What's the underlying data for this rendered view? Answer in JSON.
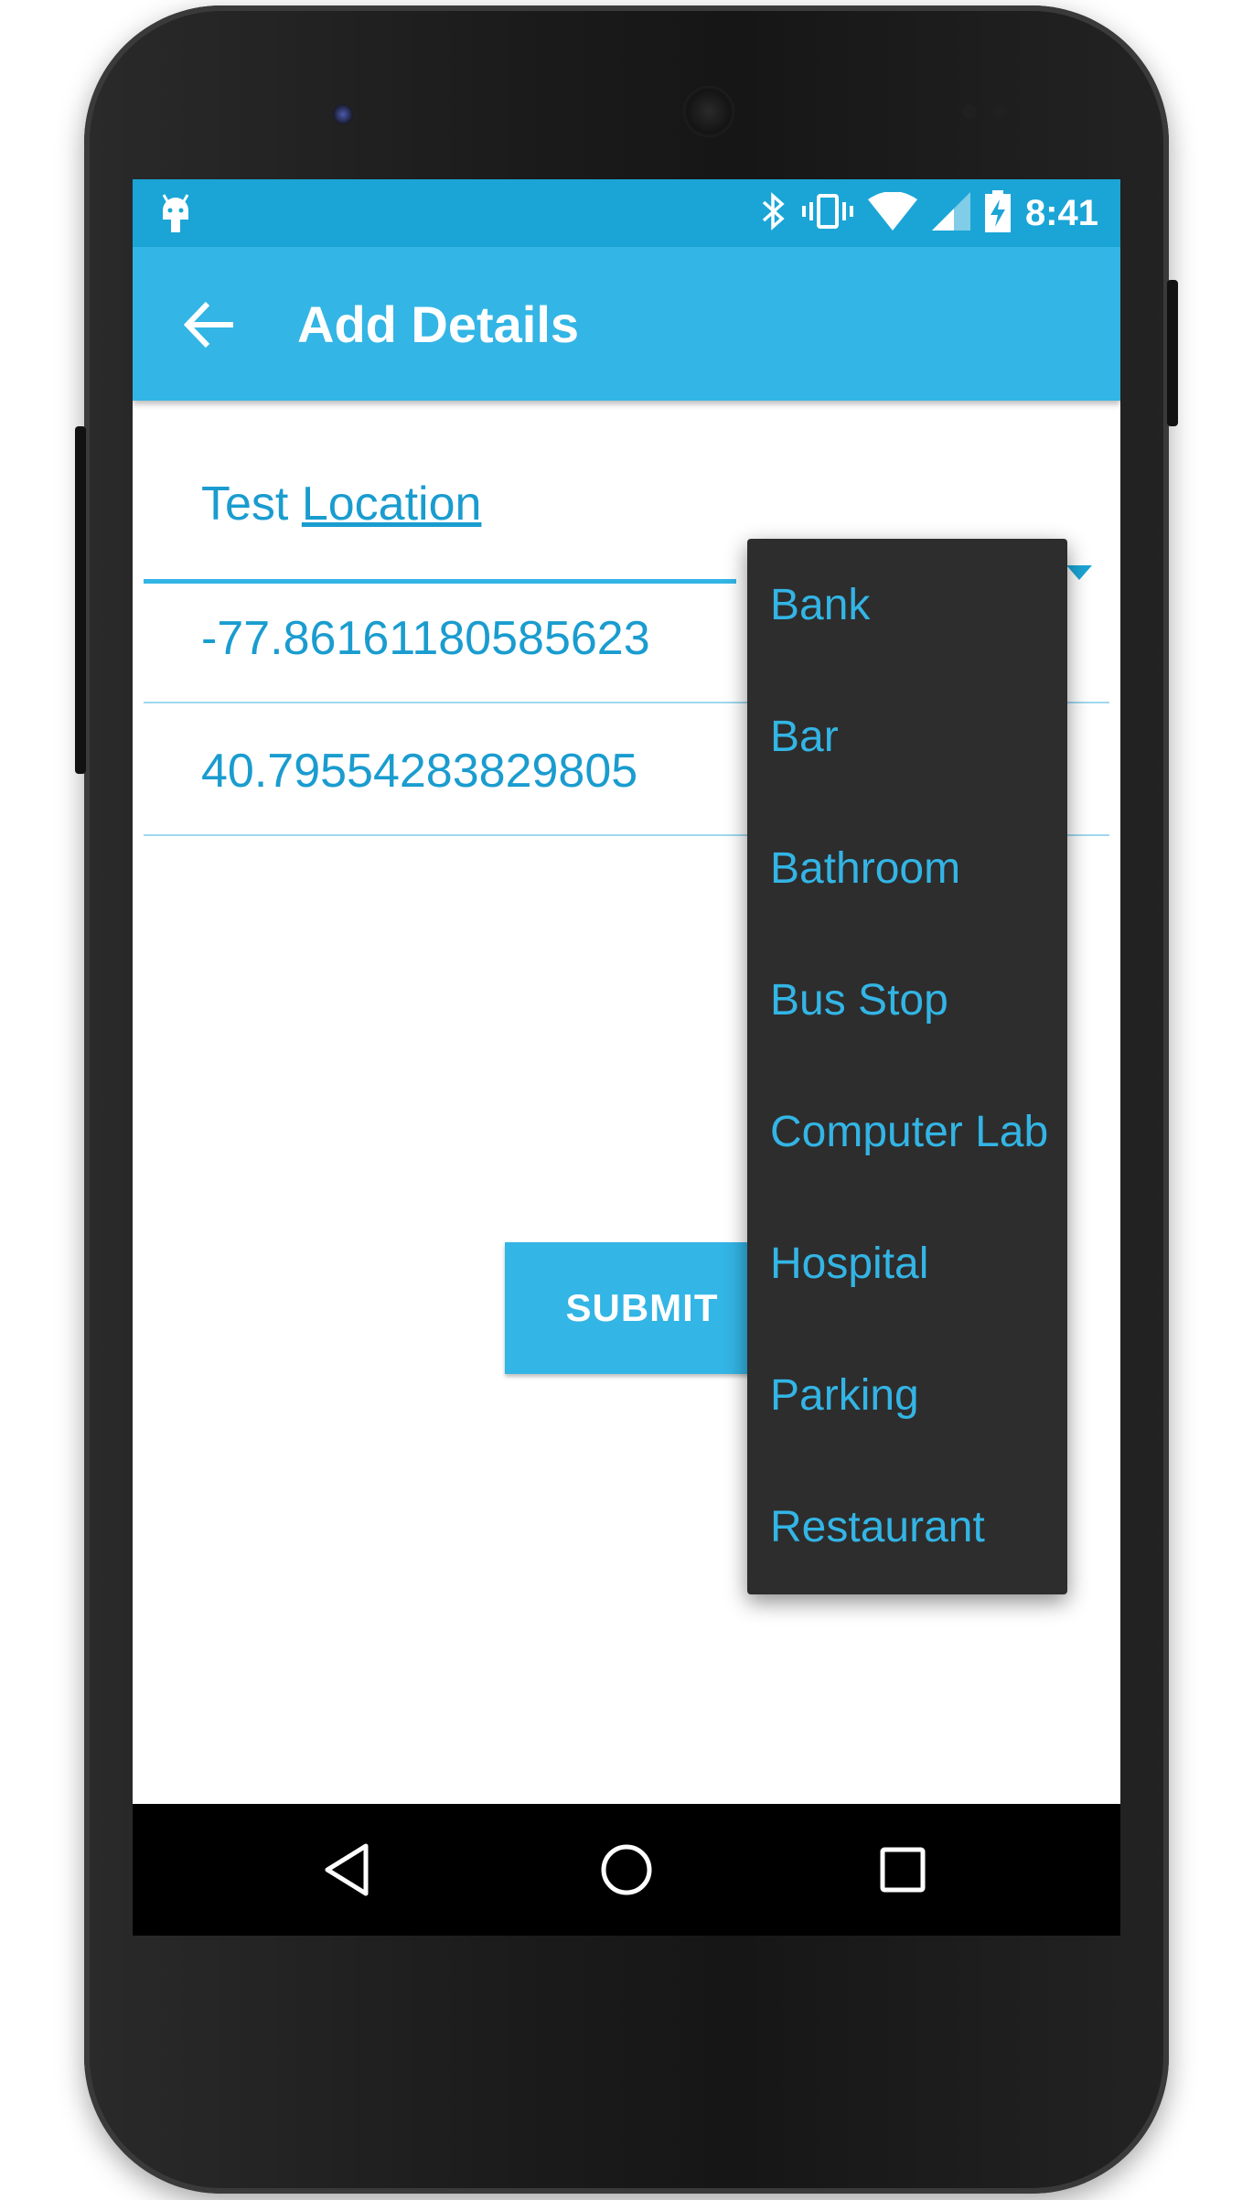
{
  "status_bar": {
    "time": "8:41",
    "icons": [
      "android-debug-icon",
      "bluetooth-icon",
      "vibrate-icon",
      "wifi-icon",
      "signal-icon",
      "battery-charging-icon"
    ]
  },
  "app_bar": {
    "title": "Add Details",
    "back_icon": "arrow-back-icon"
  },
  "form": {
    "location_name": {
      "prefix": "Test",
      "underlined": "Location"
    },
    "longitude": "-77.86161180585623",
    "latitude": "40.79554283829805",
    "submit_label": "SUBMIT"
  },
  "dropdown": {
    "options": [
      "Bank",
      "Bar",
      "Bathroom",
      "Bus Stop",
      "Computer Lab",
      "Hospital",
      "Parking",
      "Restaurant"
    ]
  },
  "nav_bar": {
    "buttons": [
      "back-triangle-icon",
      "home-circle-icon",
      "recents-square-icon"
    ]
  },
  "colors": {
    "status_bar": "#1ba5d6",
    "app_bar": "#33b5e5",
    "accent_text": "#1a9ccf",
    "dropdown_bg": "#2d2d2d"
  }
}
